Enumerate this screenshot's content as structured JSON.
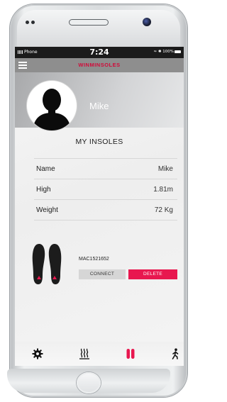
{
  "status_bar": {
    "carrier": "Phone",
    "time": "7:24",
    "battery": "100%"
  },
  "app_bar": {
    "menu_icon": "hamburger-menu-icon",
    "brand_label": "WINMINSOLES"
  },
  "profile": {
    "name": "Mike",
    "avatar_icon": "user-silhouette-icon"
  },
  "section_title": "MY INSOLES",
  "info_rows": [
    {
      "label": "Name",
      "value": "Mike"
    },
    {
      "label": "High",
      "value": "1.81m"
    },
    {
      "label": "Weight",
      "value": "72 Kg"
    }
  ],
  "insole": {
    "image_icon": "insoles-pair-icon",
    "mac": "MAC1521652",
    "connect_label": "CONNECT",
    "delete_label": "DELETE"
  },
  "tabs": [
    {
      "icon": "gear-icon",
      "active": false
    },
    {
      "icon": "heat-waves-icon",
      "active": false
    },
    {
      "icon": "insoles-icon",
      "active": true
    },
    {
      "icon": "walking-person-icon",
      "active": false
    }
  ],
  "colors": {
    "accent": "#e8174f",
    "brand": "#d10b3a",
    "app_bar": "#8e8e8e",
    "status_bar": "#1b1b1b"
  }
}
